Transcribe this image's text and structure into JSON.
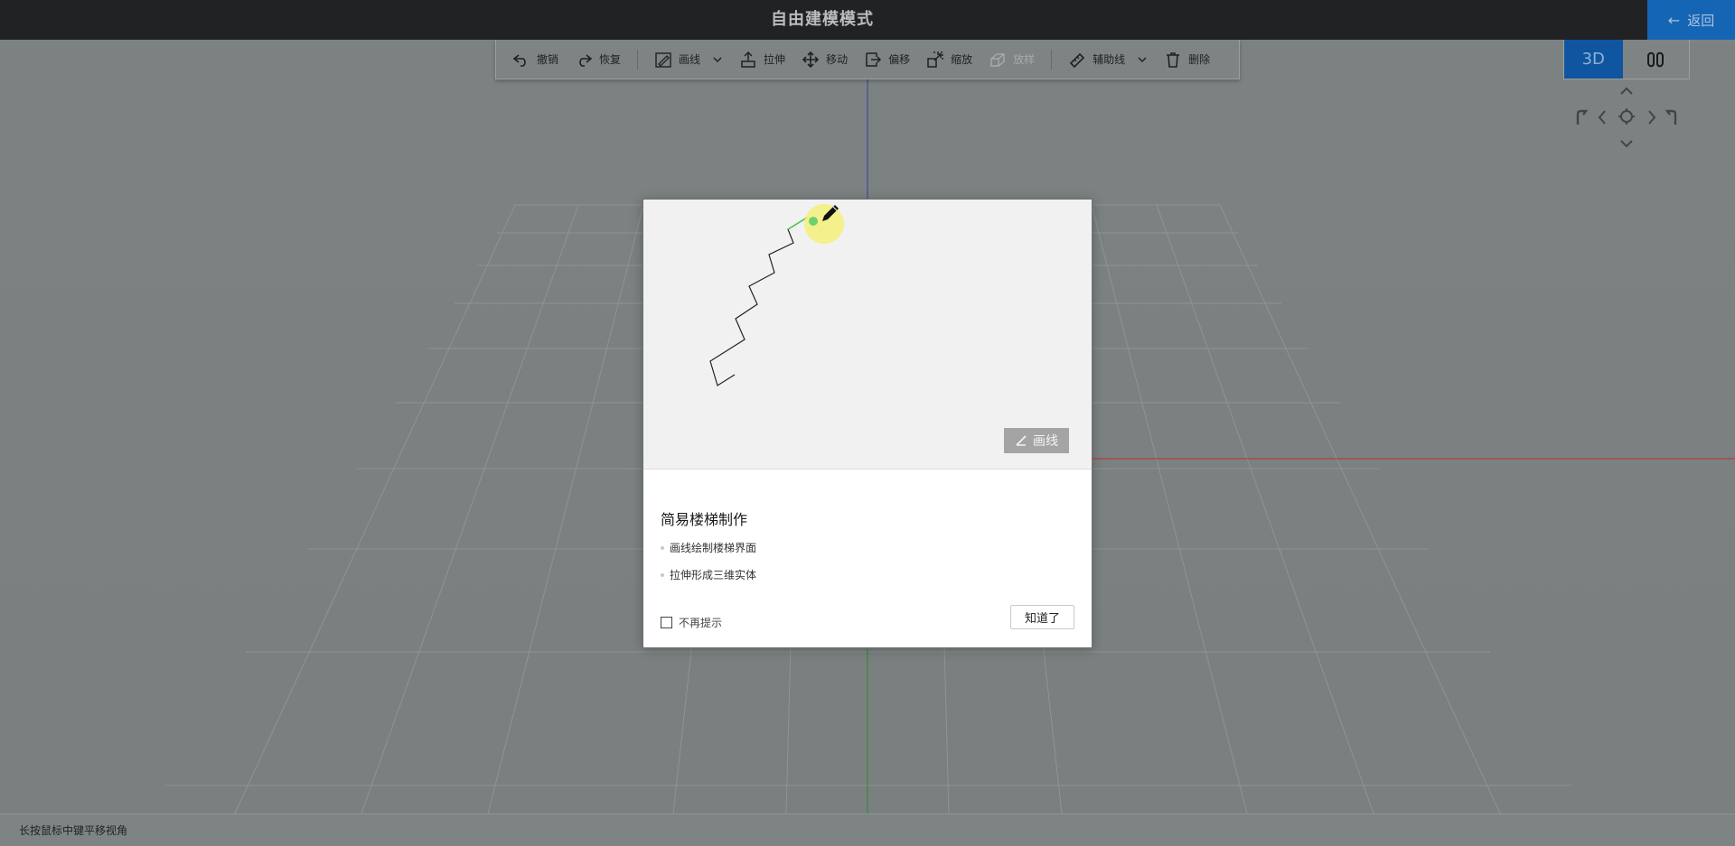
{
  "app": {
    "title": "自由建模模式",
    "back_label": "返回"
  },
  "toolbar": {
    "undo": "撤销",
    "redo": "恢复",
    "draw_line": "画线",
    "extrude": "拉伸",
    "move": "移动",
    "offset": "偏移",
    "scale": "缩放",
    "loft": "放样",
    "guide_line": "辅助线",
    "delete": "删除"
  },
  "view_switch": {
    "mode_3d": "3D",
    "active": "3D"
  },
  "status_bar": {
    "hint": "长按鼠标中键平移视角"
  },
  "modal": {
    "preview_badge": "画线",
    "title": "简易楼梯制作",
    "bullets": [
      "画线绘制楼梯界面",
      "拉伸形成三维实体"
    ],
    "dont_show_again": "不再提示",
    "dont_show_checked": false,
    "confirm_label": "知道了"
  },
  "colors": {
    "brand_blue": "#1565b5",
    "axis_x": "#c03030",
    "axis_y": "#2a8a2a",
    "axis_z": "#3a3aa0"
  }
}
